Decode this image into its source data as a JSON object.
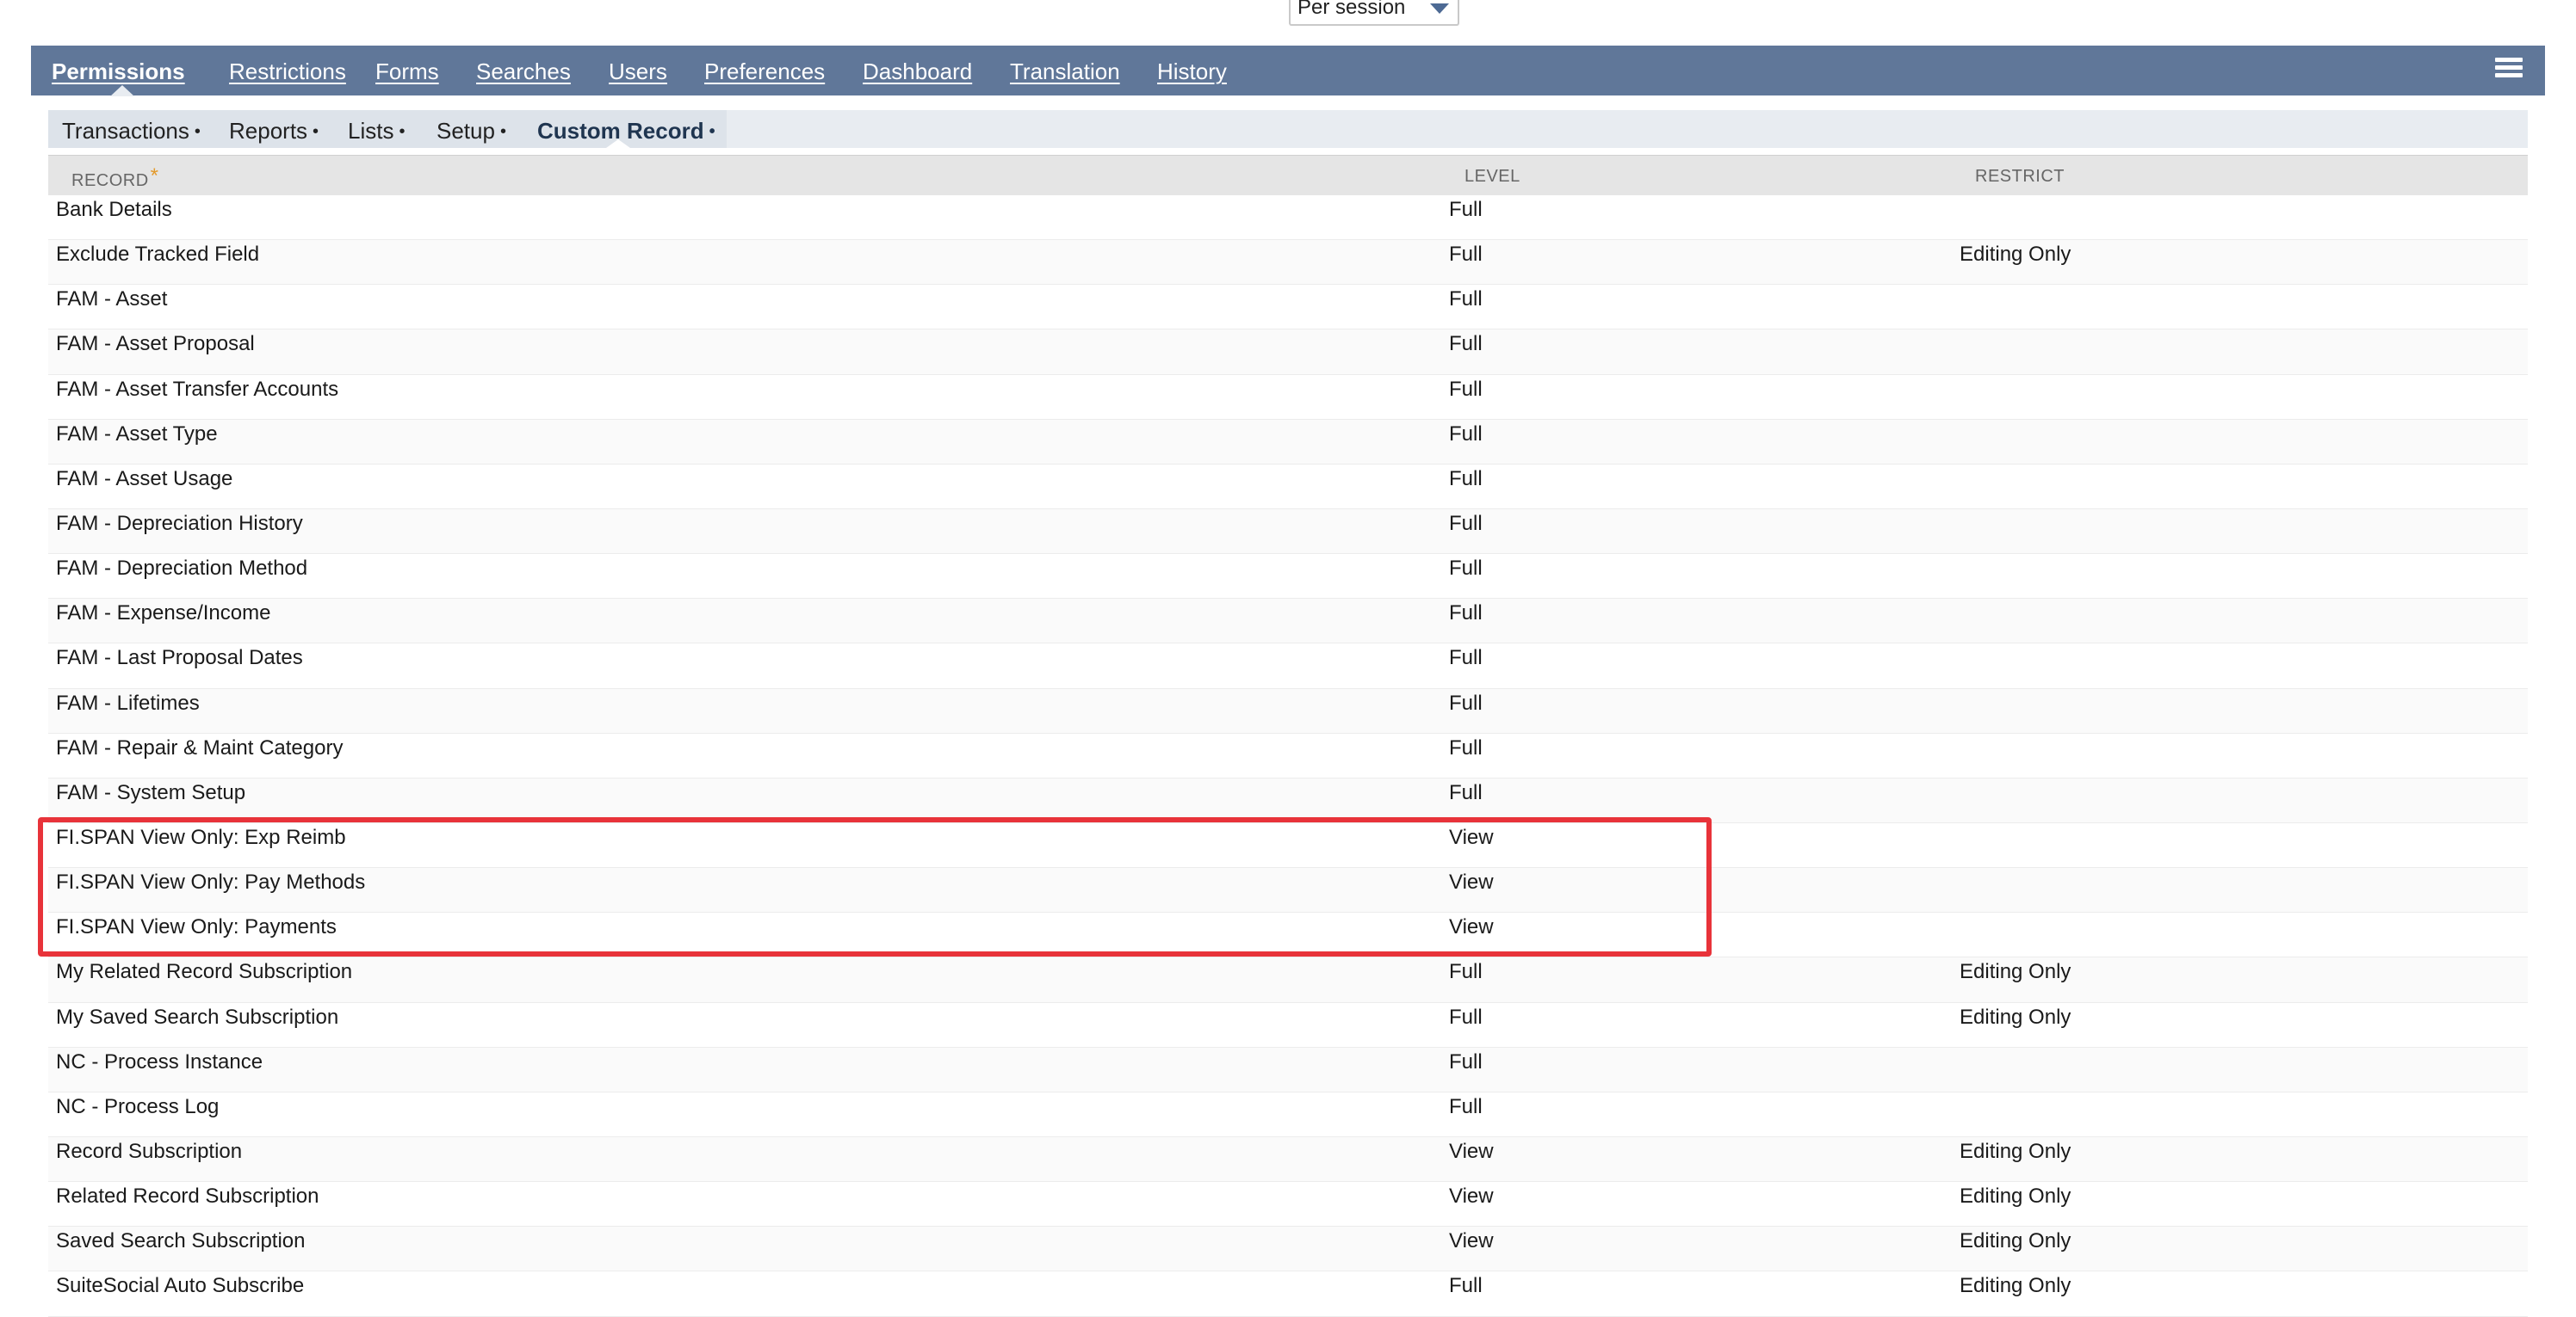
{
  "session_select": {
    "value": "Per session"
  },
  "main_nav": {
    "tabs": [
      {
        "label": "Permissions",
        "active": true
      },
      {
        "label": "Restrictions"
      },
      {
        "label": "Forms"
      },
      {
        "label": "Searches"
      },
      {
        "label": "Users"
      },
      {
        "label": "Preferences"
      },
      {
        "label": "Dashboard"
      },
      {
        "label": "Translation"
      },
      {
        "label": "History"
      }
    ]
  },
  "sub_nav": {
    "tabs": [
      {
        "label": "Transactions"
      },
      {
        "label": "Reports"
      },
      {
        "label": "Lists"
      },
      {
        "label": "Setup"
      },
      {
        "label": "Custom Record",
        "active": true
      }
    ],
    "dot": "•"
  },
  "table": {
    "headers": {
      "record": "RECORD",
      "record_required": "*",
      "level": "LEVEL",
      "restrict": "RESTRICT"
    },
    "rows": [
      {
        "record": "Bank Details",
        "level": "Full",
        "restrict": ""
      },
      {
        "record": "Exclude Tracked Field",
        "level": "Full",
        "restrict": "Editing Only"
      },
      {
        "record": "FAM - Asset",
        "level": "Full",
        "restrict": ""
      },
      {
        "record": "FAM - Asset Proposal",
        "level": "Full",
        "restrict": ""
      },
      {
        "record": "FAM - Asset Transfer Accounts",
        "level": "Full",
        "restrict": ""
      },
      {
        "record": "FAM - Asset Type",
        "level": "Full",
        "restrict": ""
      },
      {
        "record": "FAM - Asset Usage",
        "level": "Full",
        "restrict": ""
      },
      {
        "record": "FAM - Depreciation History",
        "level": "Full",
        "restrict": ""
      },
      {
        "record": "FAM - Depreciation Method",
        "level": "Full",
        "restrict": ""
      },
      {
        "record": "FAM - Expense/Income",
        "level": "Full",
        "restrict": ""
      },
      {
        "record": "FAM - Last Proposal Dates",
        "level": "Full",
        "restrict": ""
      },
      {
        "record": "FAM - Lifetimes",
        "level": "Full",
        "restrict": ""
      },
      {
        "record": "FAM - Repair & Maint Category",
        "level": "Full",
        "restrict": ""
      },
      {
        "record": "FAM - System Setup",
        "level": "Full",
        "restrict": ""
      },
      {
        "record": "FI.SPAN View Only: Exp Reimb",
        "level": "View",
        "restrict": ""
      },
      {
        "record": "FI.SPAN View Only: Pay Methods",
        "level": "View",
        "restrict": ""
      },
      {
        "record": "FI.SPAN View Only: Payments",
        "level": "View",
        "restrict": ""
      },
      {
        "record": "My Related Record Subscription",
        "level": "Full",
        "restrict": "Editing Only"
      },
      {
        "record": "My Saved Search Subscription",
        "level": "Full",
        "restrict": "Editing Only"
      },
      {
        "record": "NC - Process Instance",
        "level": "Full",
        "restrict": ""
      },
      {
        "record": "NC - Process Log",
        "level": "Full",
        "restrict": ""
      },
      {
        "record": "Record Subscription",
        "level": "View",
        "restrict": "Editing Only"
      },
      {
        "record": "Related Record Subscription",
        "level": "View",
        "restrict": "Editing Only"
      },
      {
        "record": "Saved Search Subscription",
        "level": "View",
        "restrict": "Editing Only"
      },
      {
        "record": "SuiteSocial Auto Subscribe",
        "level": "Full",
        "restrict": "Editing Only"
      }
    ]
  },
  "colors": {
    "nav_bg": "#607799",
    "subnav_bg": "#e8ecf1",
    "highlight": "#e8333a",
    "required": "#e39a2c"
  }
}
